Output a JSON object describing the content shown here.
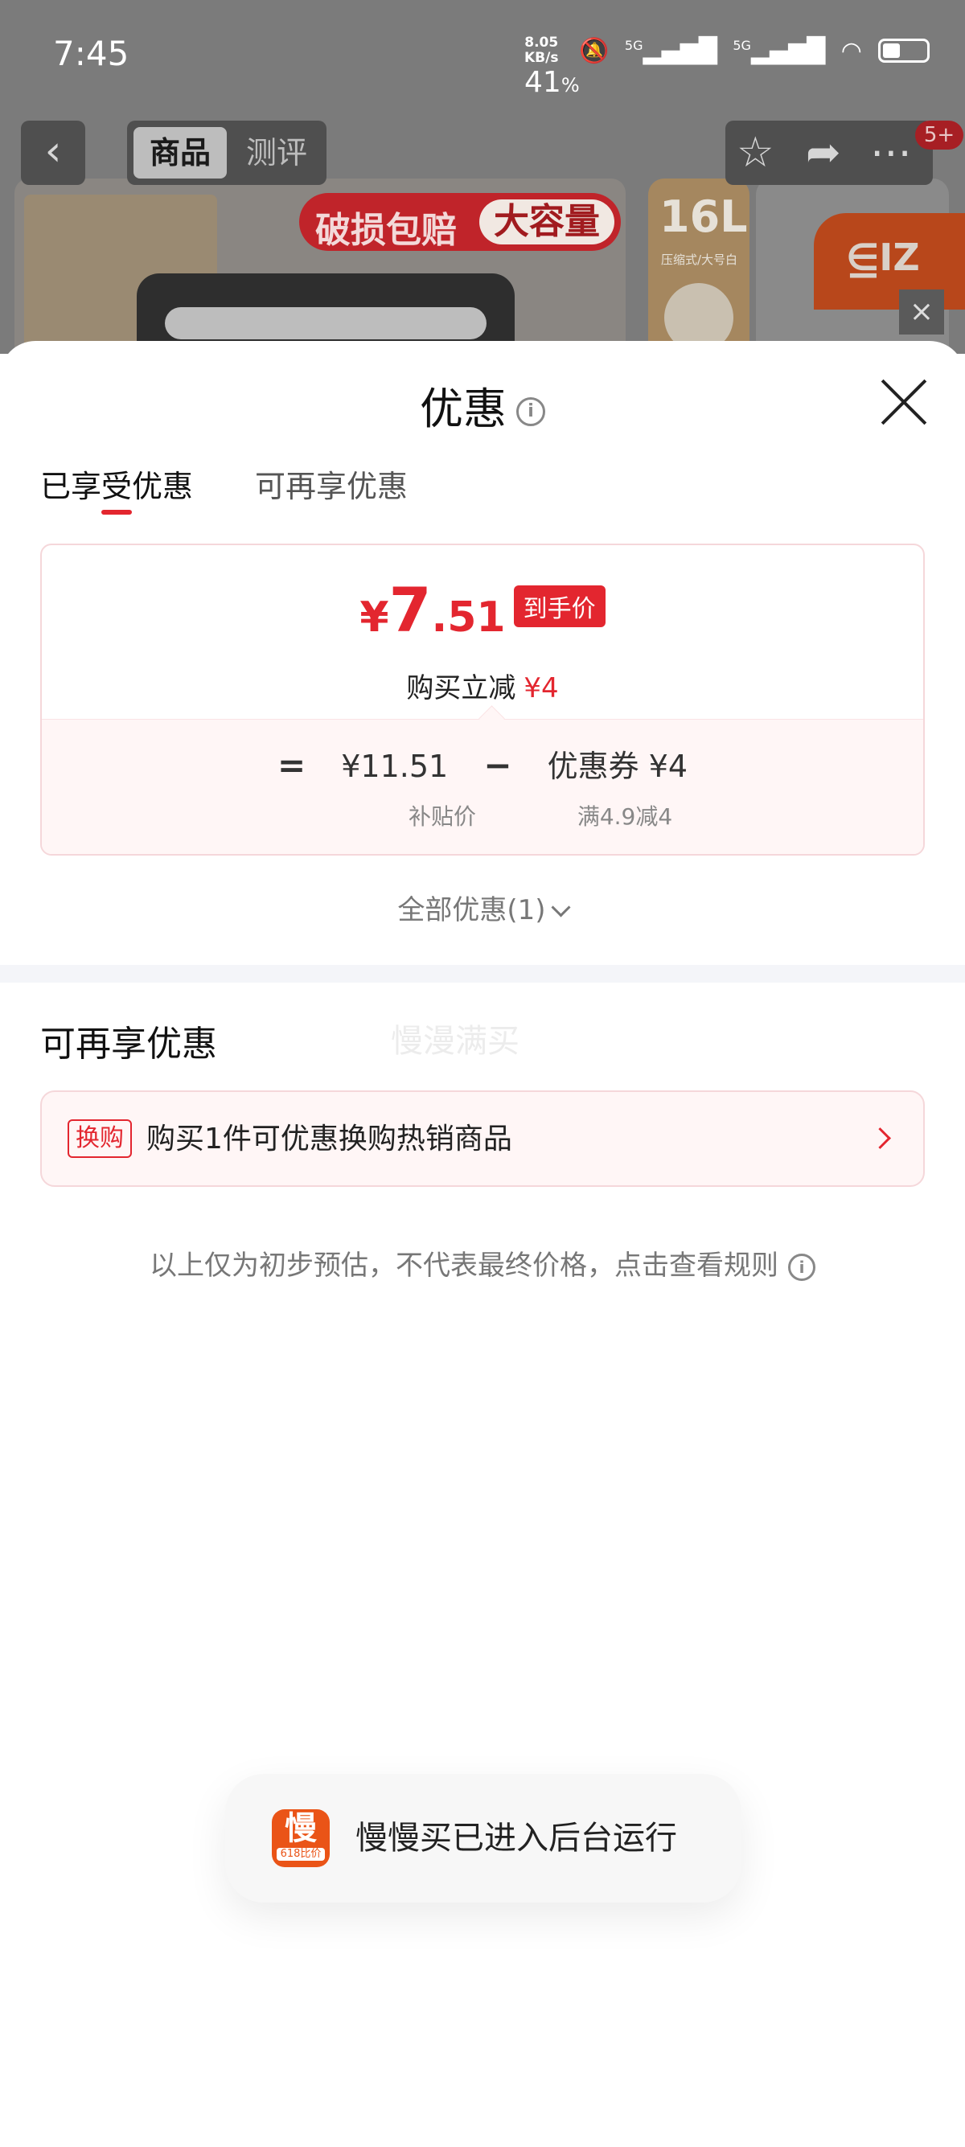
{
  "status_bar": {
    "time": "7:45",
    "net_speed_value": "8.05",
    "net_speed_unit": "KB/s",
    "signal1": "5G",
    "signal2": "5G",
    "battery_percent": "41",
    "battery_level": 0.41
  },
  "product_page": {
    "tab_goods": "商品",
    "tab_review": "测评",
    "message_badge": "5+",
    "promo_text1": "破损包赔",
    "promo_text2": "大容量",
    "capacity": "16L",
    "capacity_sub": "压缩式/大号白"
  },
  "sheet": {
    "title": "优惠",
    "tabs": [
      {
        "label": "已享受优惠",
        "active": true
      },
      {
        "label": "可再享优惠",
        "active": false
      }
    ],
    "price_card": {
      "currency": "¥",
      "price_int": "7",
      "price_dec": ".51",
      "final_tag": "到手价",
      "reduce_label": "购买立减",
      "reduce_amount": "¥4",
      "eq": "=",
      "subsidy_price": "¥11.51",
      "minus": "−",
      "coupon": "优惠券 ¥4",
      "subsidy_label": "补贴价",
      "coupon_rule": "满4.9减4"
    },
    "all_offers": "全部优惠(1)",
    "section_title": "可再享优惠",
    "watermark": "慢漫满买",
    "exchange": {
      "tag": "换购",
      "text": "购买1件可优惠换购热销商品"
    },
    "disclaimer": "以上仅为初步预估，不代表最终价格，点击查看规则"
  },
  "toast": {
    "icon_char": "慢",
    "icon_sub": "618比价",
    "message": "慢慢买已进入后台运行"
  },
  "colors": {
    "accent": "#e3262f",
    "toast_icon": "#ea5417"
  }
}
